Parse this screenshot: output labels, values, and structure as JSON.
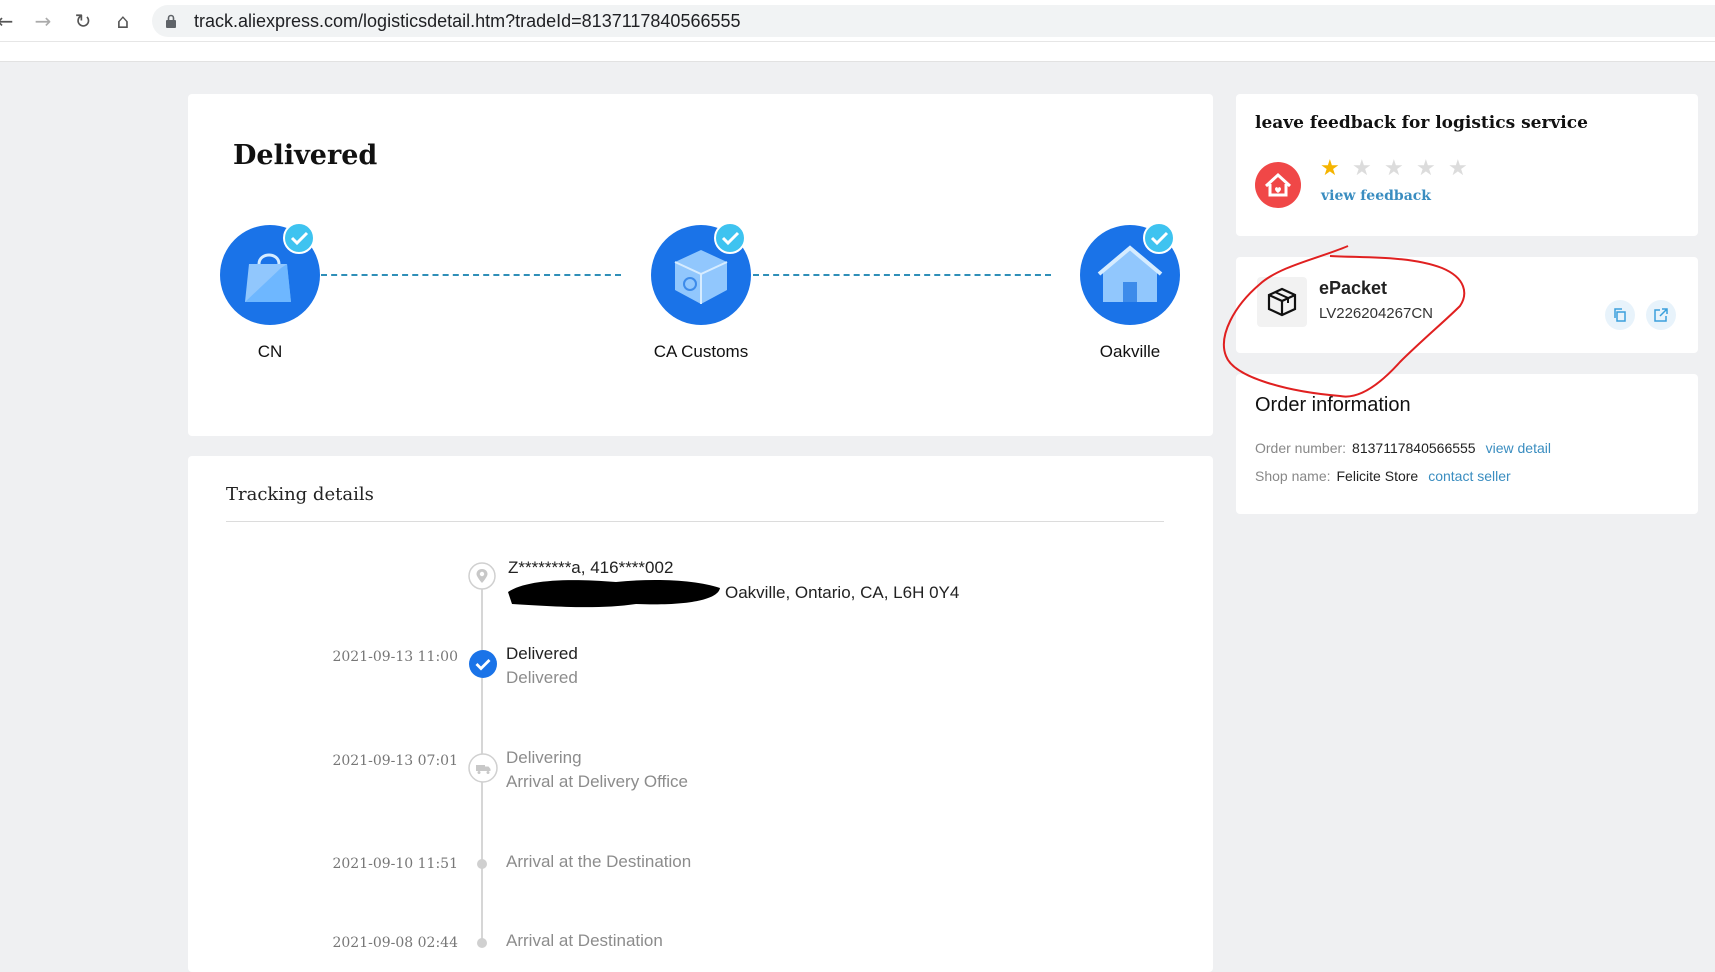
{
  "browser": {
    "url": "track.aliexpress.com/logisticsdetail.htm?tradeId=8137117840566555"
  },
  "status": {
    "title": "Delivered",
    "route": [
      {
        "label": "CN",
        "icon": "shopping-bag-icon"
      },
      {
        "label": "CA Customs",
        "icon": "customs-package-icon"
      },
      {
        "label": "Oakville",
        "icon": "house-icon"
      }
    ],
    "node_color": "#1a73e8",
    "check_color": "#3ec3f0"
  },
  "tracking": {
    "title": "Tracking details",
    "recipient": "Z********a,  416****002",
    "address": "Oakville,  Ontario,  CA,  L6H 0Y4",
    "events": [
      {
        "time": "2021-09-13 11:00",
        "title": "Delivered",
        "sub": "Delivered"
      },
      {
        "time": "2021-09-13 07:01",
        "title": "Delivering",
        "sub": "Arrival at Delivery Office"
      },
      {
        "time": "2021-09-10 11:51",
        "title": "Arrival at the Destination",
        "sub": ""
      },
      {
        "time": "2021-09-08 02:44",
        "title": "Arrival at Destination",
        "sub": ""
      }
    ]
  },
  "feedback": {
    "title": "leave feedback for logistics service",
    "rating": 1,
    "max_rating": 5,
    "link": "view feedback"
  },
  "carrier": {
    "name": "ePacket",
    "tracking_number": "LV226204267CN"
  },
  "order": {
    "title": "Order information",
    "number_label": "Order number:",
    "number": "8137117840566555",
    "detail_link": "view detail",
    "shop_label": "Shop name:",
    "shop": "Felicite Store",
    "contact_link": "contact seller"
  },
  "colors": {
    "accent": "#3a8dc0",
    "annotation_red": "#e02020"
  }
}
